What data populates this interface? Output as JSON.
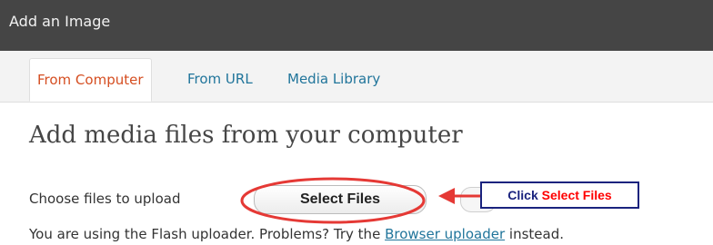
{
  "window": {
    "title": "Add an Image"
  },
  "tabs": [
    {
      "label": "From Computer",
      "active": true
    },
    {
      "label": "From URL",
      "active": false
    },
    {
      "label": "Media Library",
      "active": false
    }
  ],
  "main": {
    "heading": "Add media files from your computer",
    "choose_label": "Choose files to upload",
    "select_button": "Select Files",
    "callout": {
      "prefix": "Click",
      "highlight": "Select Files"
    },
    "status": {
      "before": "You are using the Flash uploader. Problems? Try the",
      "link": "Browser uploader",
      "after": "instead."
    }
  },
  "colors": {
    "titlebar": "#454545",
    "tab_active": "#d54e21",
    "link": "#21759b",
    "annotation_red": "#ff0000",
    "callout_border": "#1a237e"
  }
}
